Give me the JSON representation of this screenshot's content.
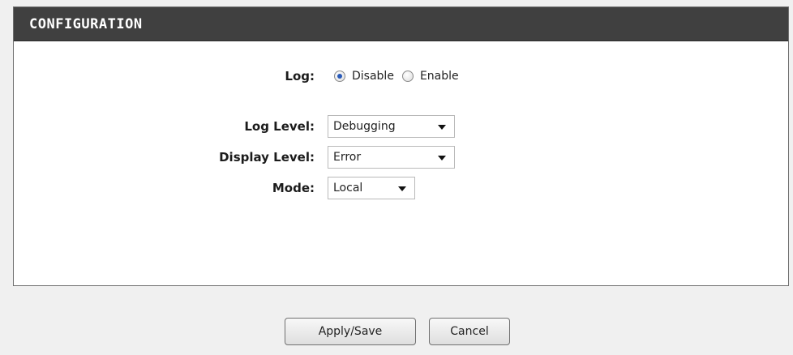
{
  "panel": {
    "title": "CONFIGURATION"
  },
  "log": {
    "label": "Log:",
    "options": [
      {
        "label": "Disable",
        "checked": true
      },
      {
        "label": "Enable",
        "checked": false
      }
    ]
  },
  "log_level": {
    "label": "Log Level:",
    "value": "Debugging"
  },
  "display_level": {
    "label": "Display Level:",
    "value": "Error"
  },
  "mode": {
    "label": "Mode:",
    "value": "Local"
  },
  "buttons": {
    "apply_save": "Apply/Save",
    "cancel": "Cancel"
  },
  "colors": {
    "header_bg": "#404040",
    "page_bg": "#f0f0f0",
    "radio_selected": "#2a5bb8"
  }
}
